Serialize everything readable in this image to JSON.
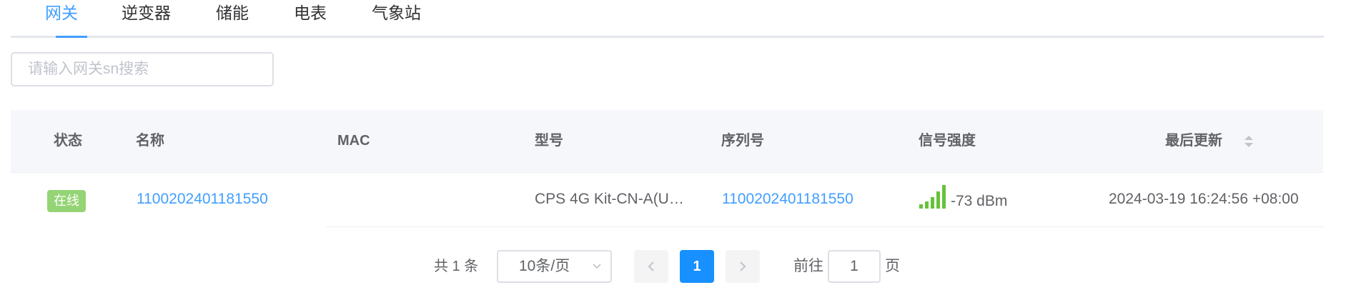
{
  "tabs": [
    {
      "label": "网关",
      "active": true
    },
    {
      "label": "逆变器",
      "active": false
    },
    {
      "label": "储能",
      "active": false
    },
    {
      "label": "电表",
      "active": false
    },
    {
      "label": "气象站",
      "active": false
    }
  ],
  "search": {
    "placeholder": "请输入网关sn搜索",
    "value": ""
  },
  "table": {
    "columns": [
      "状态",
      "名称",
      "MAC",
      "型号",
      "序列号",
      "信号强度",
      "最后更新"
    ],
    "sortable_column": "最后更新",
    "rows": [
      {
        "status": "在线",
        "name": "1100202401181550",
        "mac": "",
        "model": "CPS 4G Kit-CN-A(U…",
        "serial": "1100202401181550",
        "signal_level": 5,
        "signal_text": "-73 dBm",
        "last_update": "2024-03-19 16:24:56 +08:00"
      }
    ]
  },
  "pagination": {
    "total_text": "共 1 条",
    "page_size_text": "10条/页",
    "current_page": "1",
    "goto_label": "前往",
    "goto_value": "1",
    "goto_suffix": "页"
  },
  "colors": {
    "accent": "#409eff",
    "status_online": "#95d475",
    "signal": "#67c23a",
    "active_page": "#1890ff"
  }
}
